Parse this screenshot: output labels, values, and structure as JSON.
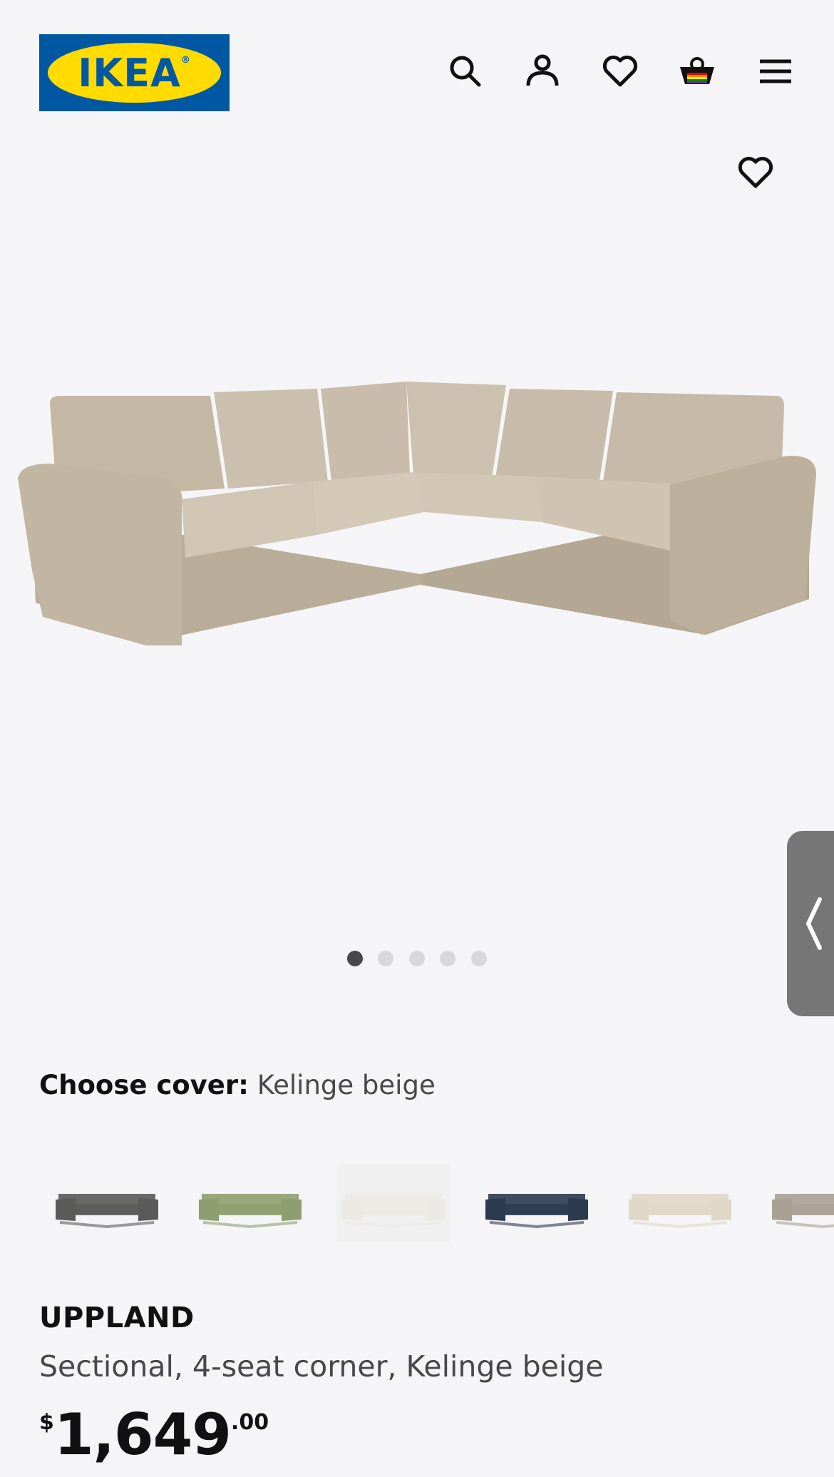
{
  "brand": {
    "logo_text": "IKEA"
  },
  "header": {
    "icons": [
      "search-icon",
      "account-icon",
      "heart-icon",
      "cart-icon",
      "menu-icon"
    ]
  },
  "gallery": {
    "image_count": 5,
    "active_index": 0
  },
  "cover": {
    "label": "Choose cover:",
    "value": "Kelinge beige"
  },
  "swatches": [
    {
      "name": "dark-grey",
      "color": "#5a5a58"
    },
    {
      "name": "green",
      "color": "#8e9e6e"
    },
    {
      "name": "white",
      "color": "#ebe9e4"
    },
    {
      "name": "dark-blue",
      "color": "#2b3a4e"
    },
    {
      "name": "light-beige",
      "color": "#e0d8c6"
    },
    {
      "name": "beige",
      "color": "#a9a194"
    }
  ],
  "product": {
    "name": "UPPLAND",
    "description": "Sectional, 4-seat corner, Kelinge beige",
    "price": {
      "currency": "$",
      "integer": "1,649",
      "decimal": ".00"
    }
  },
  "colors": {
    "logo_blue": "#0058a3",
    "logo_yellow": "#ffdb00",
    "sofa": "#c9bcaa"
  }
}
